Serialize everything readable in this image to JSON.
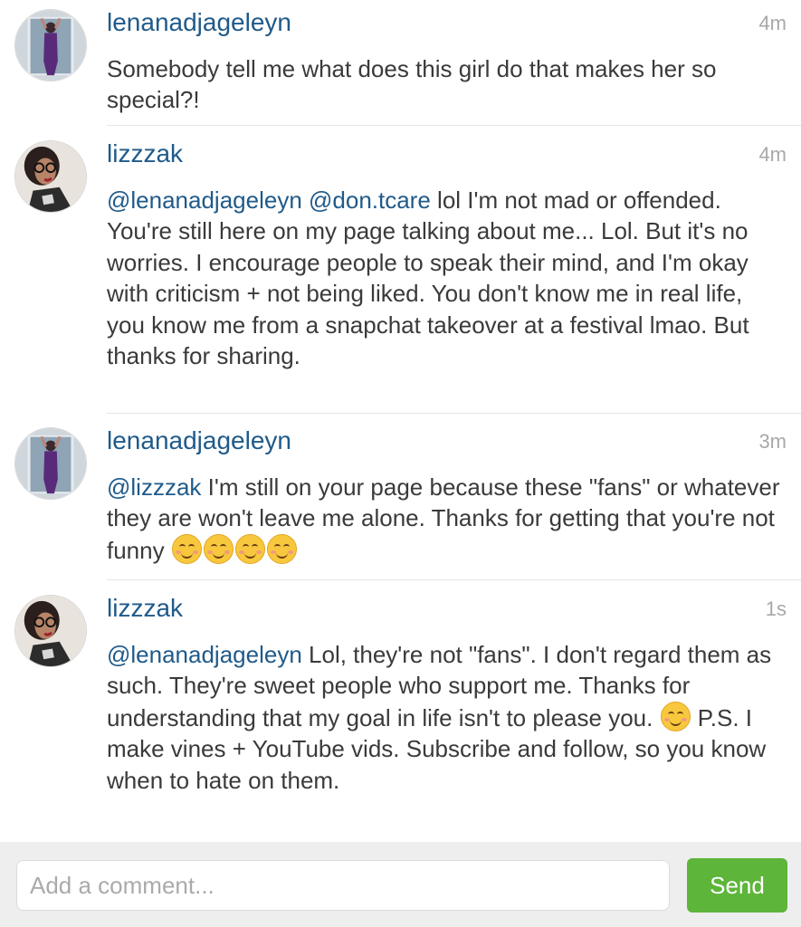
{
  "comments": [
    {
      "username": "lenanadjageleyn",
      "time": "4m",
      "mention": "",
      "text": "Somebody tell me what does this girl do that makes her so special?!"
    },
    {
      "username": "lizzzak",
      "time": "4m",
      "mention": "@lenanadjageleyn @don.tcare",
      "text": " lol I'm not mad or offended. You're still here on my page talking about me... Lol. But it's no worries. I encourage people to speak their mind, and I'm okay with criticism + not being liked. You don't know me in real life, you know me from a snapchat takeover at a festival lmao. But thanks for sharing."
    },
    {
      "username": "lenanadjageleyn",
      "time": "3m",
      "mention": "@lizzzak",
      "text": " I'm still on your page because these \"fans\" or whatever they are won't leave me alone. Thanks for getting that you're not funny "
    },
    {
      "username": "lizzzak",
      "time": "1s",
      "mention": "@lenanadjageleyn",
      "text": " Lol, they're not \"fans\". I don't regard them as such. They're sweet people who support me. Thanks for understanding that my goal in life isn't to please you. ",
      "text_after": " P.S. I make vines + YouTube vids. Subscribe and follow, so you know when to hate on them."
    }
  ],
  "emoji_icon": "smiling-face-emoji",
  "composer": {
    "placeholder": "Add a comment...",
    "send_label": "Send"
  },
  "colors": {
    "username": "#1f5a8a",
    "send_button": "#5db53a",
    "timestamp": "#a8a8a8"
  }
}
